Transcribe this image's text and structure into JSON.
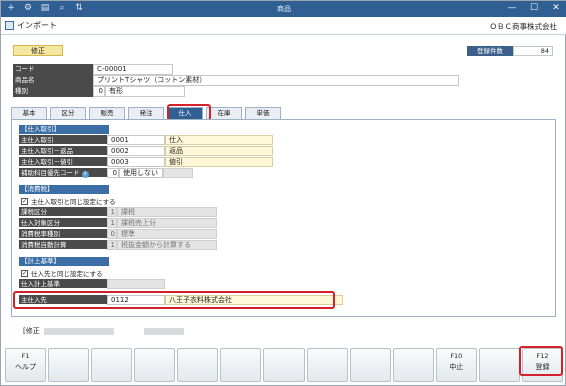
{
  "window": {
    "title": "商品",
    "controls": [
      "—",
      "☐",
      "✕"
    ]
  },
  "toolbar_icons": [
    "add-icon",
    "settings-icon",
    "print-icon",
    "search-icon",
    "sort-icon"
  ],
  "header": {
    "import_label": "インポート",
    "company": "ＯＢＣ商事株式会社"
  },
  "mode": {
    "label": "修正"
  },
  "count": {
    "label": "登録件数",
    "value": "84"
  },
  "fields": {
    "code_label": "コード",
    "code": "C-00001",
    "name_label": "商品名",
    "name": "プリントTシャツ（コットン素材）",
    "type_label": "種別",
    "type_code": "0",
    "type_name": "有形"
  },
  "tabs": [
    "基本",
    "区分",
    "販売",
    "発注",
    "仕入",
    "在庫",
    "単価"
  ],
  "purchase": {
    "section": "【仕入取引】",
    "rows": [
      {
        "label": "主仕入取引",
        "code": "0001",
        "name": "仕入"
      },
      {
        "label": "主仕入取引－返品",
        "code": "0002",
        "name": "返品"
      },
      {
        "label": "主仕入取引－値引",
        "code": "0003",
        "name": "値引"
      }
    ],
    "aux_label": "補助科目優先コード",
    "aux_code": "0",
    "aux_name": "使用しない",
    "info_icon": "ℹ"
  },
  "tax": {
    "section": "【消費税】",
    "checkbox": "主仕入取引と同じ設定にする",
    "rows": [
      {
        "label": "課税区分",
        "code": "1",
        "name": "課税"
      },
      {
        "label": "仕入対象区分",
        "code": "1",
        "name": "課税売上分"
      },
      {
        "label": "消費税率種別",
        "code": "0",
        "name": "標準"
      },
      {
        "label": "消費税自動計算",
        "code": "1",
        "name": "税抜金額から計算する"
      }
    ]
  },
  "basis": {
    "section": "【計上基準】",
    "checkbox": "仕入先と同じ設定にする",
    "row_label": "仕入計上基準"
  },
  "supplier": {
    "label": "主仕入先",
    "code": "0112",
    "name": "八王子衣料株式会社"
  },
  "status": {
    "text": "[修正"
  },
  "fkeys": [
    {
      "key": "F1",
      "label": "ヘルプ"
    },
    {
      "key": "",
      "label": ""
    },
    {
      "key": "",
      "label": ""
    },
    {
      "key": "",
      "label": ""
    },
    {
      "key": "",
      "label": ""
    },
    {
      "key": "",
      "label": ""
    },
    {
      "key": "",
      "label": ""
    },
    {
      "key": "",
      "label": ""
    },
    {
      "key": "",
      "label": ""
    },
    {
      "key": "",
      "label": ""
    },
    {
      "key": "F10",
      "label": "中止"
    },
    {
      "key": "",
      "label": ""
    },
    {
      "key": "F12",
      "label": "登録"
    }
  ]
}
